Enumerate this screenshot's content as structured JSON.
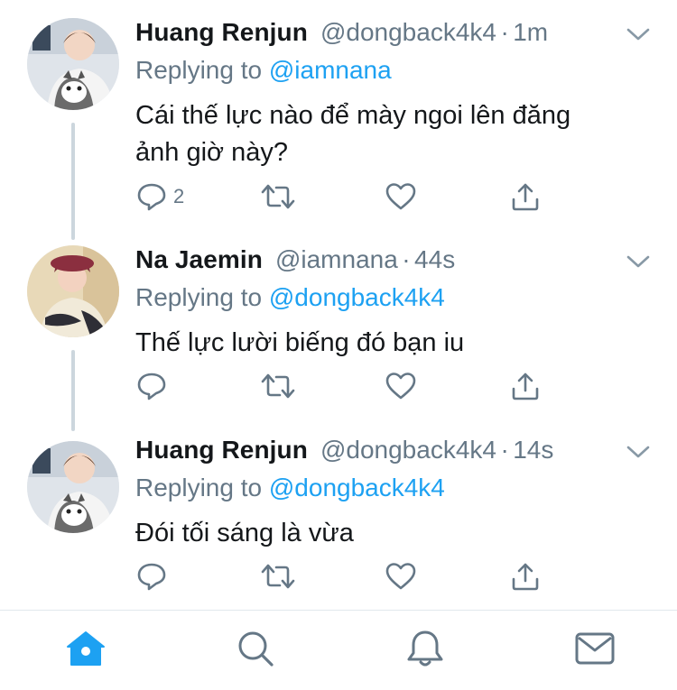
{
  "tweets": [
    {
      "name": "Huang Renjun",
      "handle": "@dongback4k4",
      "dot": "·",
      "time": "1m",
      "replying_prefix": "Replying to ",
      "replying_to": "@iamnana",
      "text_line1": "Cái thế lực nào để mày ngoi lên đăng",
      "text_line2": "ảnh giờ này?",
      "reply_count": "2"
    },
    {
      "name": "Na Jaemin",
      "handle": "@iamnana",
      "dot": "·",
      "time": "44s",
      "replying_prefix": "Replying to ",
      "replying_to": "@dongback4k4",
      "text_line1": "Thế lực lười biếng đó bạn iu",
      "reply_count": ""
    },
    {
      "name": "Huang Renjun",
      "handle": "@dongback4k4",
      "dot": "·",
      "time": "14s",
      "replying_prefix": "Replying to ",
      "replying_to": "@dongback4k4",
      "text_line1": "Đói tối sáng là vừa",
      "reply_count": ""
    }
  ],
  "icons": {
    "reply": "reply-icon",
    "retweet": "retweet-icon",
    "like": "heart-icon",
    "share": "share-icon",
    "more": "chevron-down-icon"
  },
  "tabbar": {
    "items": [
      "home-icon",
      "search-icon",
      "notifications-icon",
      "messages-icon"
    ],
    "active": "home-icon"
  },
  "colors": {
    "accent": "#1da1f2",
    "muted": "#657786",
    "text": "#14171a",
    "thread_line": "#ccd6dd"
  }
}
